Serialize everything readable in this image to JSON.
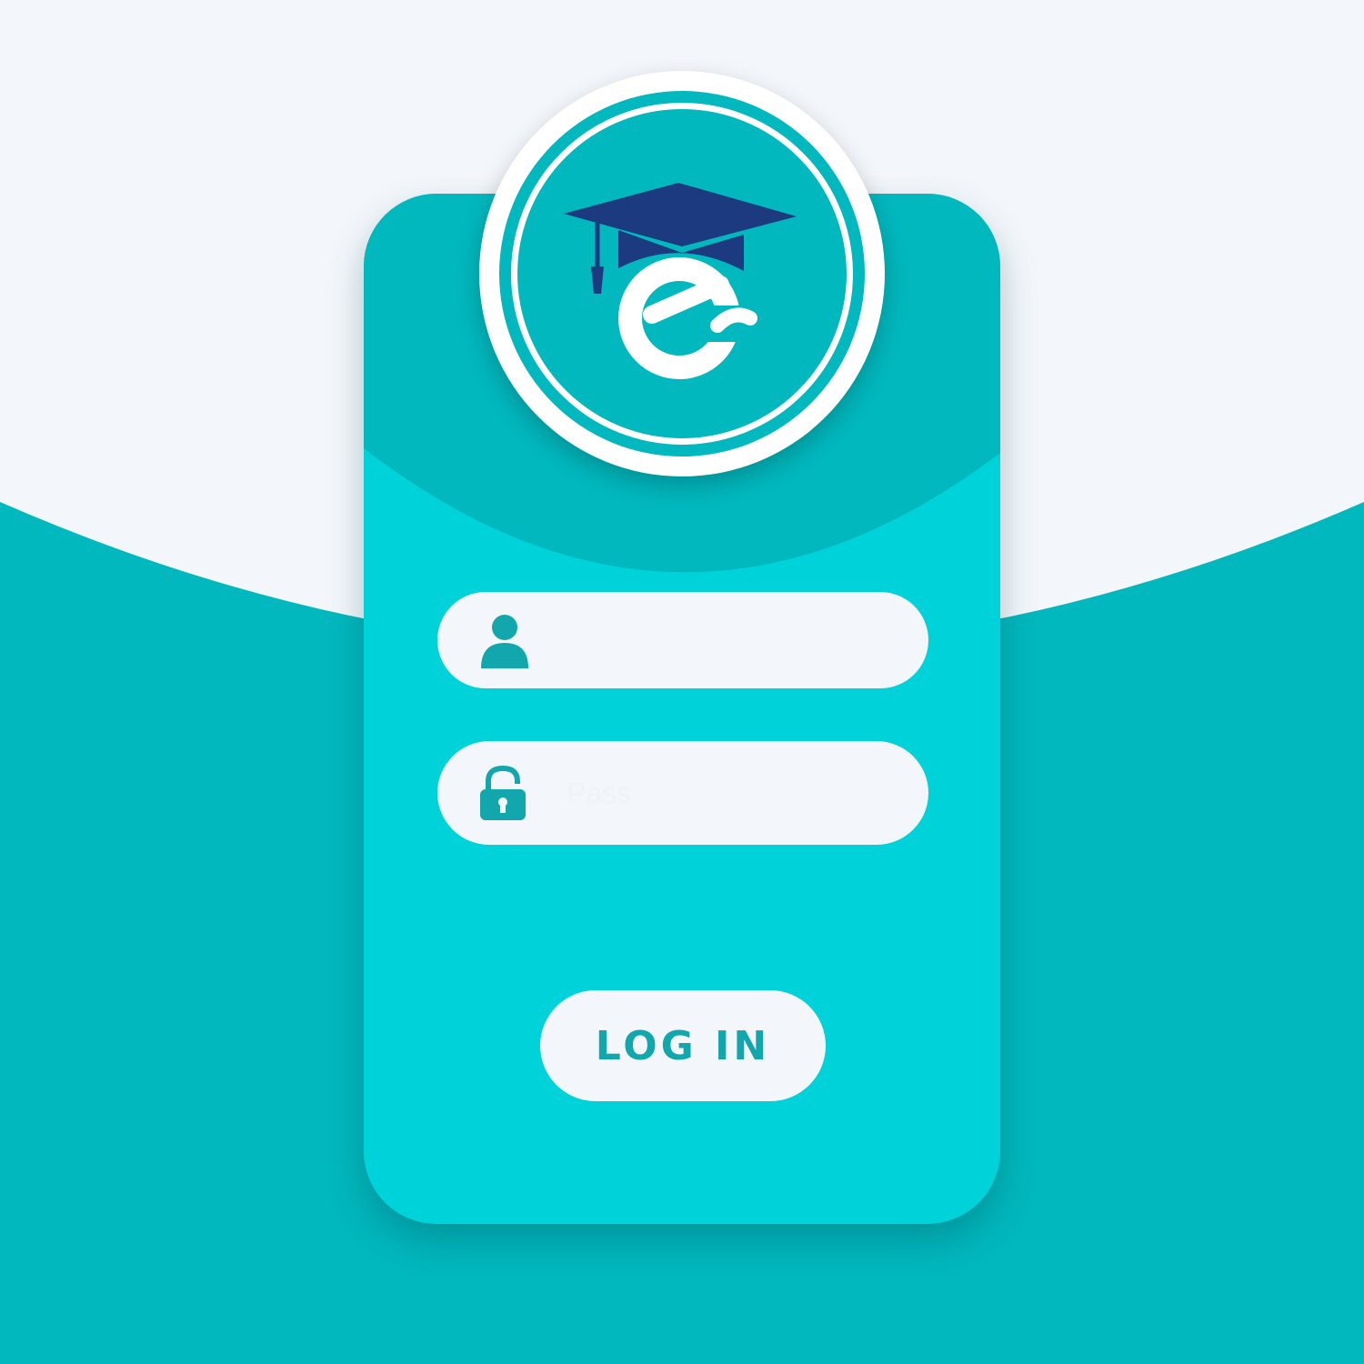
{
  "colors": {
    "background_light": "#f3f7fb",
    "background_teal": "#00b8be",
    "card_teal": "#00d2d9",
    "card_top_teal": "#00b8be",
    "icon_teal": "#12a6ad",
    "cap_navy": "#1c3a80"
  },
  "logo": {
    "icon": "graduation-cap-e-logo",
    "letter": "e"
  },
  "form": {
    "username": {
      "icon": "user-icon",
      "value": "",
      "placeholder": ""
    },
    "password": {
      "icon": "lock-icon",
      "value": "",
      "placeholder": "Pass"
    },
    "login_label": "LOG IN"
  }
}
